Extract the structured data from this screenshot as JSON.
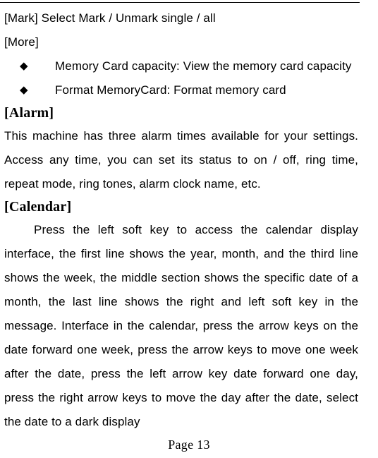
{
  "document": {
    "page_label": "Page 13",
    "header_rule": true
  },
  "body": {
    "mark_line": "[Mark] Select Mark / Unmark single / all",
    "more_line": "[More]",
    "bullets": [
      {
        "marker": "◆",
        "text": "Memory Card capacity: View the memory card capacity"
      },
      {
        "marker": "◆",
        "text": "Format MemoryCard: Format memory card"
      }
    ],
    "sections": [
      {
        "heading": "[Alarm]",
        "paragraph": "This machine has three alarm times available for your settings. Access any time, you can set its status to on / off, ring time, repeat mode, ring tones, alarm clock name, etc.",
        "indent_first_line": false
      },
      {
        "heading": "[Calendar]",
        "paragraph": "Press the left soft key to access the calendar display interface, the first line shows the year, month, and the third line shows the week, the middle section shows the specific date of a month, the last line shows the right and left soft key in the message. Interface in the calendar, press the arrow keys on the date forward one week, press the arrow keys to move one week after the date, press the left arrow key date forward one day, press the right arrow keys to move the day after the date, select the date to a dark display",
        "indent_first_line": true
      }
    ]
  }
}
